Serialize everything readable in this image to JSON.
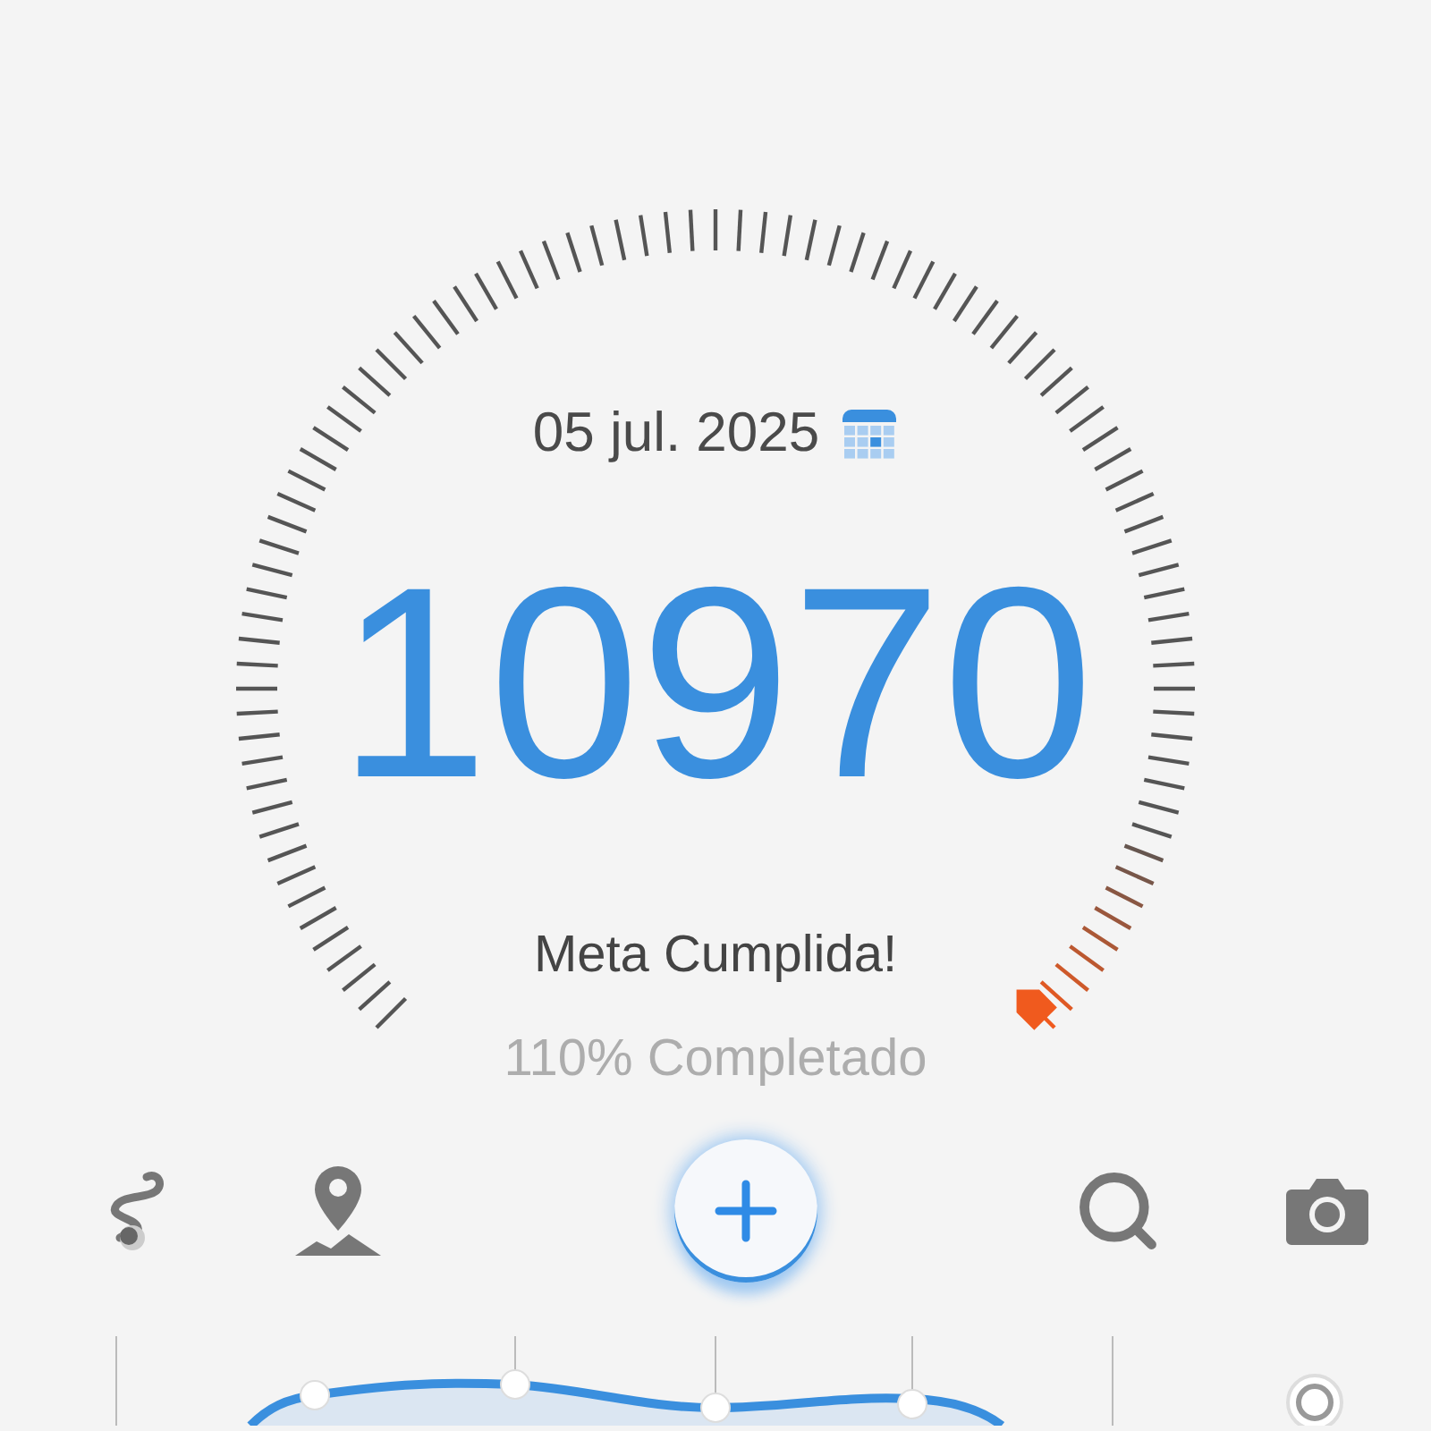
{
  "date": "05 jul. 2025",
  "steps": "10970",
  "status": "Meta Cumplida!",
  "progress": "110% Completado"
}
